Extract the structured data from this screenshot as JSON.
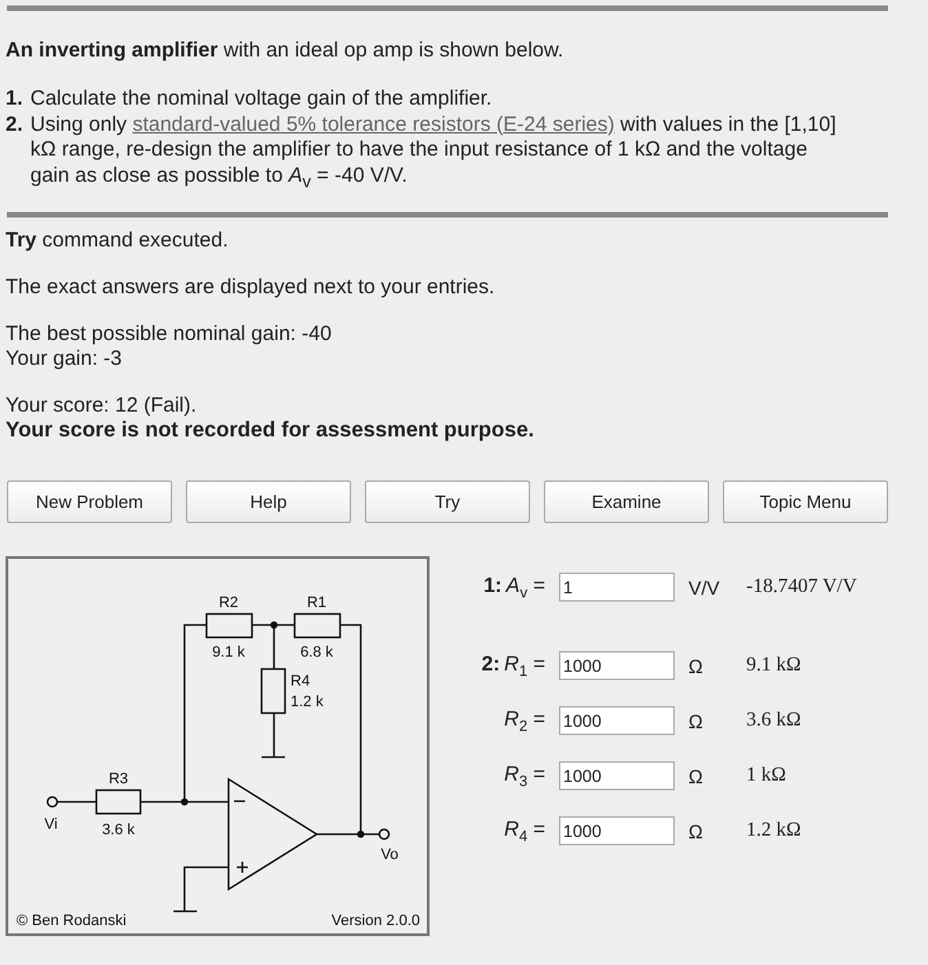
{
  "intro": "**An inverting amplifier** with an ideal op amp is shown below.",
  "tasks": [
    {
      "number": "1.",
      "before": "Calculate the nominal voltage gain of the amplifier."
    },
    {
      "number": "2.",
      "before": "Using only ",
      "link": "standard-valued 5% tolerance resistors (E-24 series)",
      "after": " with values in the [1,10] kΩ range, re-design the amplifier to have the input resistance of 1 kΩ and the voltage gain as close as possible to *A*$_{v}$ = -40 V/V."
    }
  ],
  "messages": [
    {
      "kind": "plain",
      "lines": [
        "**Try** command executed."
      ]
    },
    {
      "kind": "plain",
      "lines": [
        "The exact answers are displayed next to your entries."
      ]
    },
    {
      "kind": "plain",
      "lines": [
        "The best possible nominal gain: -40",
        "Your gain: -3"
      ]
    },
    {
      "kind": "mixed",
      "lines": [
        "Your score: 12 (Fail).",
        "Your score is not recorded for assessment purpose."
      ]
    }
  ],
  "buttons": [
    "New Problem",
    "Help",
    "Try",
    "Examine",
    "Topic Menu"
  ],
  "circuit": {
    "resistors": [
      {
        "label": "R2",
        "value": "9.1 k"
      },
      {
        "label": "R1",
        "value": "6.8 k"
      },
      {
        "label": "R4",
        "value": "1.2 k"
      },
      {
        "label": "R3",
        "value": "3.6 k"
      }
    ],
    "input_terminal": "Vi",
    "output_terminal": "Vo",
    "copyright": "© Ben Rodanski",
    "version": "Version 2.0.0"
  },
  "answers": [
    {
      "number": "1:",
      "symbol": "*A*$_{v}$ =",
      "value": "1",
      "unit": "V/V",
      "exact": "-18.7407 V/V"
    },
    {
      "number": "2:",
      "symbol": "*R*$_{1}$ =",
      "value": "1000",
      "unit": "Ω",
      "exact": "9.1 kΩ"
    },
    {
      "symbol": "*R*$_{2}$ =",
      "value": "1000",
      "unit": "Ω",
      "exact": "3.6 kΩ"
    },
    {
      "symbol": "*R*$_{3}$ =",
      "value": "1000",
      "unit": "Ω",
      "exact": "1 kΩ"
    },
    {
      "symbol": "*R*$_{4}$ =",
      "value": "1000",
      "unit": "Ω",
      "exact": "1.2 kΩ"
    }
  ]
}
